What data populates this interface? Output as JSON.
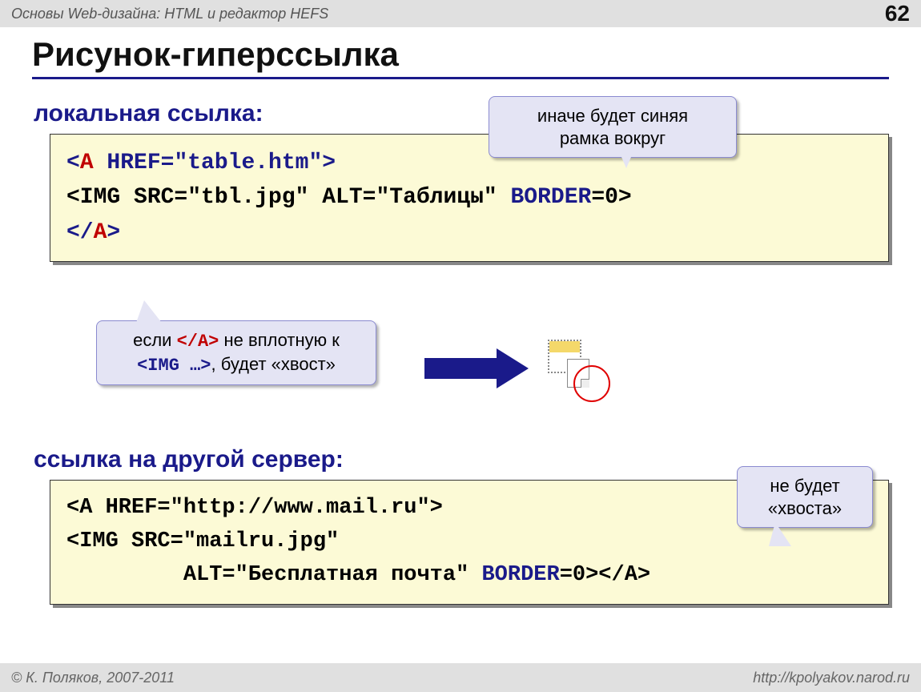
{
  "header": {
    "course": "Основы Web-дизайна: HTML и редактор HEFS",
    "page": "62"
  },
  "title": "Рисунок-гиперссылка",
  "section1": "локальная ссылка:",
  "code1": {
    "l1a": "<",
    "l1b": "A",
    "l1c": " HREF=\"table.htm\">",
    "l2": "<IMG SRC=\"tbl.jpg\" ALT=\"Таблицы\" ",
    "l2b": "BORDER",
    "l2c": "=0>",
    "l3a": "</",
    "l3b": "A",
    "l3c": ">"
  },
  "calloutTop": {
    "l1": "иначе будет синяя",
    "l2": "рамка вокруг"
  },
  "calloutMid": {
    "t1": "если ",
    "t2": "</A>",
    "t3": " не вплотную к",
    "t4": "<IMG …>",
    "t5": ", будет «хвост»"
  },
  "section2": "ссылка на другой сервер:",
  "code2": {
    "l1": "<A HREF=\"http://www.mail.ru\">",
    "l2": "<IMG SRC=\"mailru.jpg\"",
    "l3a": "         ALT=\"Бесплатная почта\" ",
    "l3b": "BORDER",
    "l3c": "=0></A>"
  },
  "calloutRight": {
    "l1": "не будет",
    "l2": "«хвоста»"
  },
  "footer": {
    "left": "© К. Поляков, 2007-2011",
    "right": "http://kpolyakov.narod.ru"
  }
}
